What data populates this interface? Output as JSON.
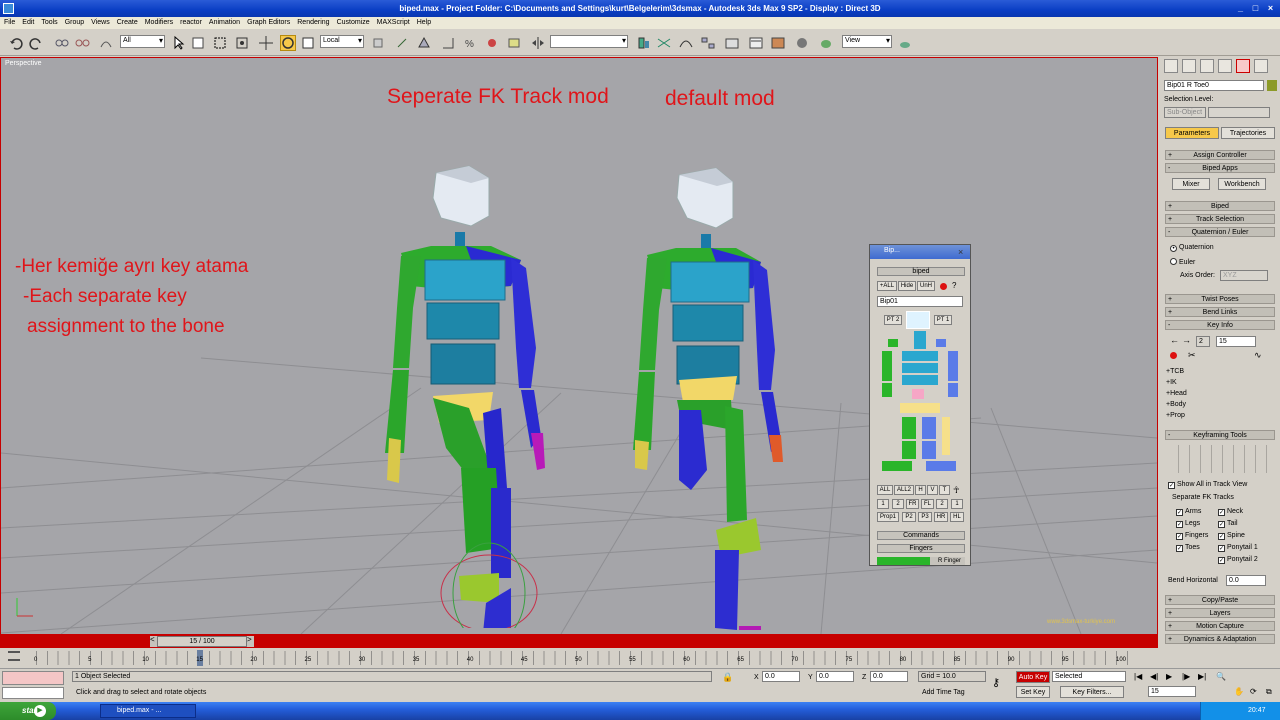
{
  "window": {
    "title": "biped.max    - Project Folder: C:\\Documents and Settings\\kurt\\Belgelerim\\3dsmax    - Autodesk 3ds Max 9 SP2    - Display : Direct 3D",
    "controls": [
      "_",
      "□",
      "×"
    ]
  },
  "menu": [
    "File",
    "Edit",
    "Tools",
    "Group",
    "Views",
    "Create",
    "Modifiers",
    "reactor",
    "Animation",
    "Graph Editors",
    "Rendering",
    "Customize",
    "MAXScript",
    "Help"
  ],
  "toolbar": {
    "selection_filter": "All",
    "ref_coord": "Local",
    "named_sel": "",
    "view_dropdown": "View"
  },
  "viewport": {
    "label": "Perspective",
    "labels": {
      "left_title": "Seperate FK Track mod",
      "right_title": "default mod",
      "note_line1": "-Her kemiğe ayrı key atama",
      "note_line2": "-Each separate key",
      "note_line3": "assignment to the bone",
      "watermark": "www.3dsmax-turkiye.com"
    }
  },
  "biped_float": {
    "title": "Bip...",
    "section_biped": "biped",
    "btns_row1": [
      "+ALL",
      "Hide",
      "UnH"
    ],
    "bip_name": "Bip01",
    "pt2": "PT 2",
    "pt1": "PT 1",
    "row_all": [
      "ALL",
      "ALL2",
      "H",
      "V",
      "T"
    ],
    "row_nums": [
      "1",
      "2",
      "FR",
      "FL",
      "2",
      "1"
    ],
    "row_props": [
      "Prop1",
      "P2",
      "P3",
      "HR",
      "HL"
    ],
    "commands": "Commands",
    "fingers": "Fingers",
    "rfinger": "R Finger"
  },
  "command_panel": {
    "object_name": "Bip01 R Toe0",
    "selection_level_label": "Selection Level:",
    "selection_level_value": "Sub-Object",
    "tab_parameters": "Parameters",
    "tab_trajectories": "Trajectories",
    "assign_controller": "Assign Controller",
    "biped_apps": "Biped Apps",
    "mixer": "Mixer",
    "workbench": "Workbench",
    "biped": "Biped",
    "track_selection": "Track Selection",
    "quat_euler": "Quaternion / Euler",
    "quaternion": "Quaternion",
    "euler": "Euler",
    "axis_order_label": "Axis Order:",
    "axis_order_value": "XYZ",
    "twist_poses": "Twist Poses",
    "bend_links": "Bend Links",
    "key_info": "Key Info",
    "key_num": "2",
    "key_frame": "15",
    "sub_rollouts": [
      "+TCB",
      "+IK",
      "+Head",
      "+Body",
      "+Prop"
    ],
    "keyframing_tools": "Keyframing Tools",
    "show_all_track": "Show All in Track View",
    "sep_fk_tracks": "Separate FK Tracks",
    "fk_left": [
      "Arms",
      "Legs",
      "Fingers",
      "Toes"
    ],
    "fk_right": [
      "Neck",
      "Tail",
      "Spine",
      "Ponytail 1",
      "Ponytail 2"
    ],
    "bend_horizontal_label": "Bend Horizontal",
    "bend_horizontal_value": "0.0",
    "copy_paste": "Copy/Paste",
    "layers": "Layers",
    "motion_capture": "Motion Capture",
    "dynamics": "Dynamics & Adaptation"
  },
  "timeline": {
    "frame_label": "15 / 100",
    "ticks": [
      "0",
      "5",
      "10",
      "15",
      "20",
      "25",
      "30",
      "35",
      "40",
      "45",
      "50",
      "55",
      "60",
      "65",
      "70",
      "75",
      "80",
      "85",
      "90",
      "95",
      "100"
    ]
  },
  "status": {
    "selected_text": "1 Object Selected",
    "prompt": "Click and drag to select and rotate objects",
    "x_label": "X",
    "x_val": "0.0",
    "y_label": "Y",
    "y_val": "0.0",
    "z_label": "Z",
    "z_val": "0.0",
    "grid": "Grid = 10.0",
    "add_time_tag": "Add Time Tag",
    "auto_key": "Auto Key",
    "selected_dd": "Selected",
    "set_key": "Set Key",
    "key_filters": "Key Filters...",
    "current_frame": "15"
  },
  "taskbar": {
    "start": "start",
    "task": "biped.max - ...",
    "clock": "20:47"
  },
  "colors": {
    "viewport_bg": "#a5a5a9",
    "active_border": "#c60000",
    "annotation": "#e0151a",
    "biped_green": "#1fa81f",
    "biped_blue": "#3535d8",
    "biped_cyan": "#2a9ec7"
  }
}
